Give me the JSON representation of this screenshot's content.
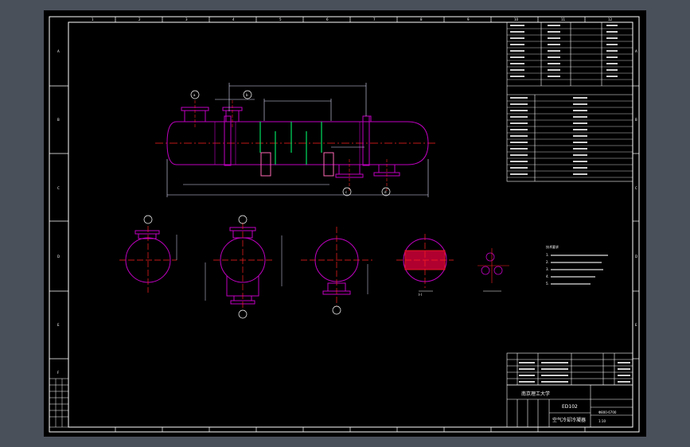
{
  "drawing": {
    "column_numbers_top": [
      "1",
      "2",
      "3",
      "4",
      "5",
      "6",
      "7",
      "8",
      "9",
      "10",
      "11",
      "12"
    ],
    "row_letters": [
      "A",
      "B",
      "C",
      "D",
      "E",
      "F"
    ],
    "scale_note": "1:10",
    "section_label": "I-I"
  },
  "title_block": {
    "school": "南京理工大学",
    "drawing_no": "ED102",
    "drawing_name": "空气冷却冷凝器",
    "drawing_code": "Φ800-6700"
  },
  "tech_requirements": {
    "title": "技术要求",
    "lines": [
      "1.",
      "2.",
      "3.",
      "4.",
      "5."
    ]
  },
  "callouts": [
    "a",
    "b",
    "c",
    "d",
    "e",
    "f",
    "g",
    "h",
    "i",
    "j"
  ],
  "colors": {
    "canvas": "#000000",
    "outer_bg": "#4a505a",
    "frame": "#ffffff",
    "vessel": "#c000c0",
    "center_line": "#ff2020",
    "tube": "#00e060",
    "dimension": "#e0e0ff"
  }
}
